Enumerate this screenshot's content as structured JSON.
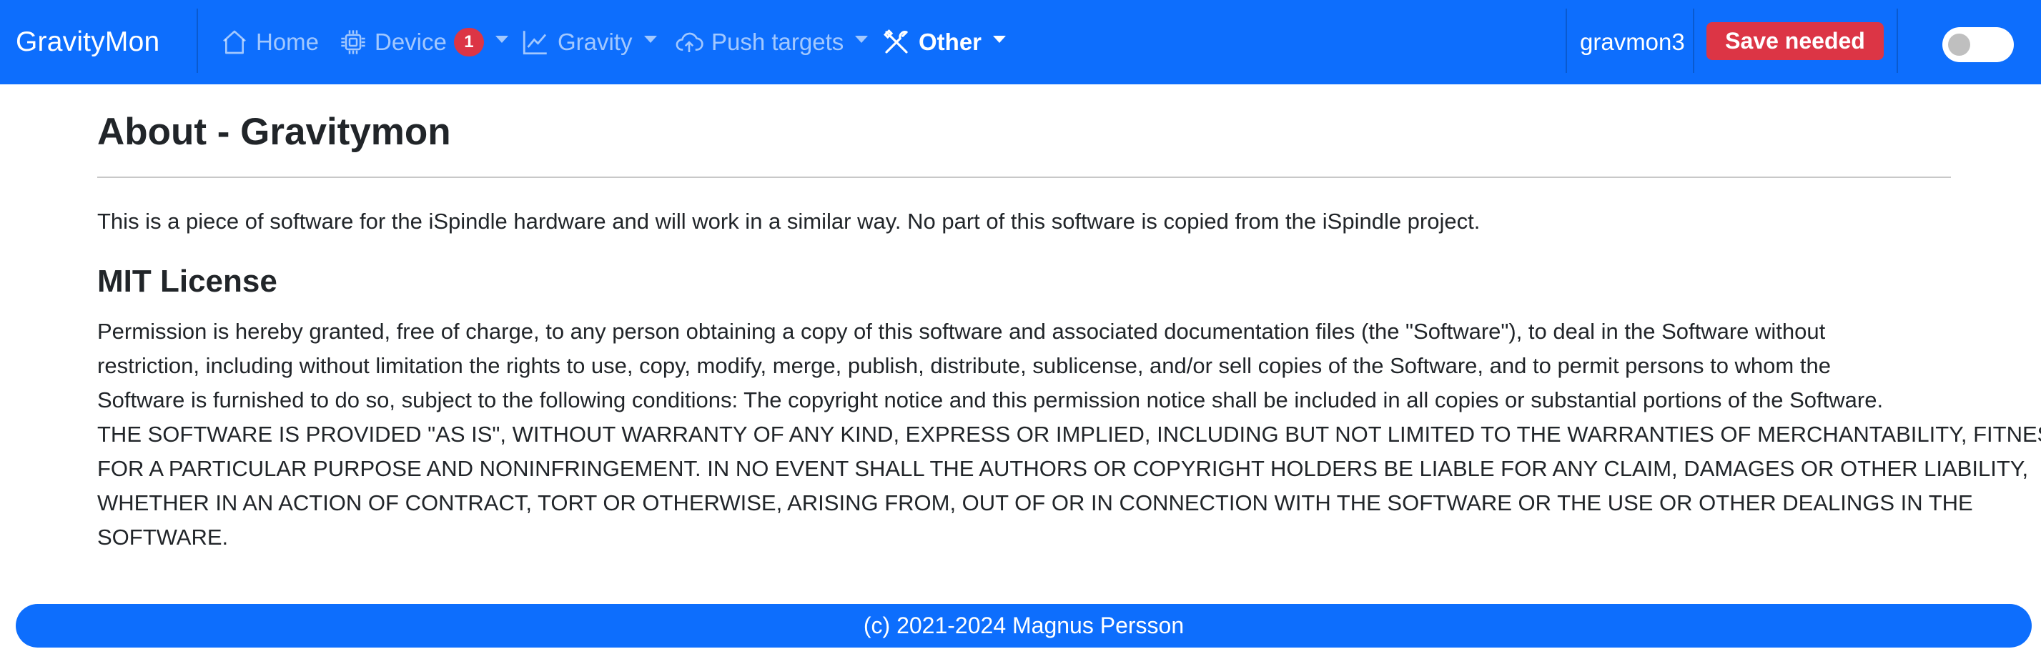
{
  "app": {
    "brand": "GravityMon"
  },
  "nav": {
    "home": "Home",
    "device": "Device",
    "device_badge": "1",
    "gravity": "Gravity",
    "push_targets": "Push targets",
    "other": "Other"
  },
  "header": {
    "hostname": "gravmon3",
    "save_label": "Save needed",
    "dark_mode_on": false
  },
  "colors": {
    "primary": "#0d6efd",
    "danger": "#dc3545",
    "text": "#212529"
  },
  "icons": [
    "house-icon",
    "cpu-chip-icon",
    "line-chart-icon",
    "cloud-upload-icon",
    "tools-icon"
  ],
  "main": {
    "title": "About - Gravitymon",
    "intro": "This is a piece of software for the iSpindle hardware and will work in a similar way. No part of this software is copied from the iSpindle project.",
    "license_title": "MIT License",
    "license_lines": [
      "Permission is hereby granted, free of charge, to any person obtaining a copy of this software and associated documentation files (the \"Software\"), to deal in the Software without",
      "restriction, including without limitation the rights to use, copy, modify, merge, publish, distribute, sublicense, and/or sell copies of the Software, and to permit persons to whom the",
      "Software is furnished to do so, subject to the following conditions: The copyright notice and this permission notice shall be included in all copies or substantial portions of the Software.",
      "THE SOFTWARE IS PROVIDED \"AS IS\", WITHOUT WARRANTY OF ANY KIND, EXPRESS OR IMPLIED, INCLUDING BUT NOT LIMITED TO THE WARRANTIES OF MERCHANTABILITY, FITNESS",
      "FOR A PARTICULAR PURPOSE AND NONINFRINGEMENT. IN NO EVENT SHALL THE AUTHORS OR COPYRIGHT HOLDERS BE LIABLE FOR ANY CLAIM, DAMAGES OR OTHER LIABILITY,",
      "WHETHER IN AN ACTION OF CONTRACT, TORT OR OTHERWISE, ARISING FROM, OUT OF OR IN CONNECTION WITH THE SOFTWARE OR THE USE OR OTHER DEALINGS IN THE",
      "SOFTWARE."
    ]
  },
  "footer": {
    "text": "(c) 2021-2024 Magnus Persson"
  }
}
